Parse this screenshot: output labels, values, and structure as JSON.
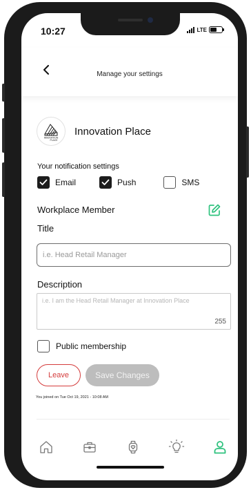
{
  "status": {
    "time": "10:27",
    "network": "LTE"
  },
  "header": {
    "title": "Manage your settings"
  },
  "org": {
    "name": "Innovation Place",
    "logo_text": "INNOVATION PLACE"
  },
  "notifications": {
    "label": "Your notification settings",
    "options": [
      {
        "label": "Email",
        "checked": true
      },
      {
        "label": "Push",
        "checked": true
      },
      {
        "label": "SMS",
        "checked": false
      }
    ]
  },
  "member": {
    "section_title": "Workplace Member",
    "title_label": "Title",
    "title_placeholder": "i.e. Head Retail Manager",
    "description_label": "Description",
    "description_placeholder": "i.e. I am the Head Retail Manager at Innovation Place",
    "description_remaining": "255",
    "public_label": "Public membership",
    "public_checked": false
  },
  "actions": {
    "leave_label": "Leave",
    "save_label": "Save Changes"
  },
  "joined_text": "You joined on Tue Oct 19, 2021 - 10:08 AM",
  "tabs": [
    {
      "icon": "home-icon",
      "active": false
    },
    {
      "icon": "briefcase-icon",
      "active": false
    },
    {
      "icon": "watch-icon",
      "active": false
    },
    {
      "icon": "lightbulb-icon",
      "active": false
    },
    {
      "icon": "profile-icon",
      "active": true
    }
  ],
  "colors": {
    "accent": "#2ec27e",
    "danger": "#d43b3b",
    "disabled": "#bdbdbd"
  }
}
